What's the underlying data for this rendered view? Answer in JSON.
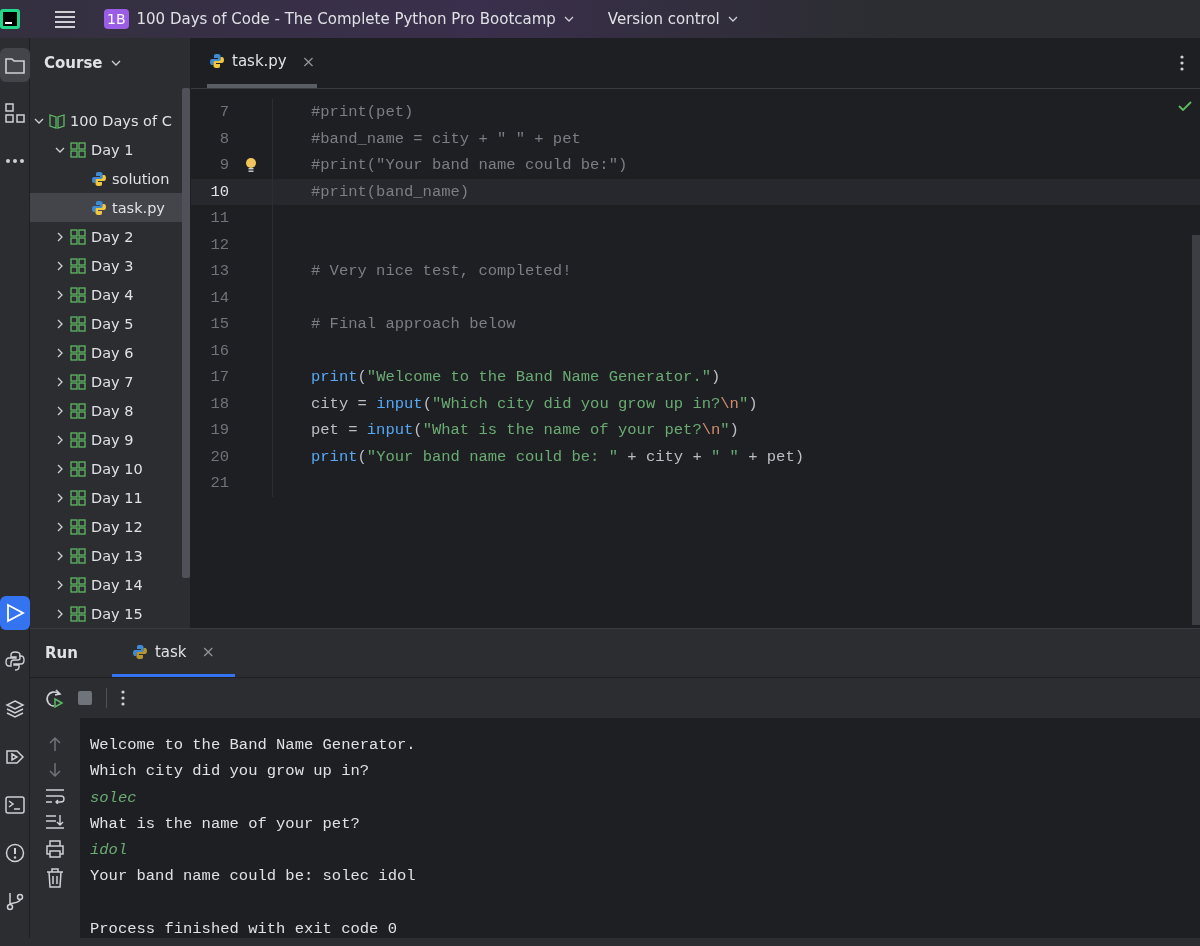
{
  "title_bar": {
    "project_badge": "1B",
    "project": "100 Days of Code - The Complete Python Pro Bootcamp",
    "vcs": "Version control"
  },
  "left_toolbar": {
    "top": [
      {
        "selected": true
      },
      {
        "selected": false
      },
      {
        "selected": false
      }
    ],
    "bottom": [
      {
        "selected": true
      },
      {
        "selected": false
      },
      {
        "selected": false
      },
      {
        "selected": false
      },
      {
        "selected": false
      },
      {
        "selected": false
      },
      {
        "selected": false
      }
    ]
  },
  "project_panel": {
    "title": "Course",
    "tree": [
      {
        "label": "100 Days of C",
        "kind": "course",
        "expanded": true,
        "selected": false,
        "children": [
          {
            "label": "Day 1",
            "kind": "lesson",
            "expanded": true,
            "selected": false,
            "children": [
              {
                "label": "solution",
                "kind": "file",
                "selected": false
              },
              {
                "label": "task.py",
                "kind": "file",
                "selected": true
              }
            ]
          },
          {
            "label": "Day 2",
            "kind": "lesson",
            "expanded": false,
            "selected": false
          },
          {
            "label": "Day 3",
            "kind": "lesson",
            "expanded": false,
            "selected": false
          },
          {
            "label": "Day 4",
            "kind": "lesson",
            "expanded": false,
            "selected": false
          },
          {
            "label": "Day 5",
            "kind": "lesson",
            "expanded": false,
            "selected": false
          },
          {
            "label": "Day 6",
            "kind": "lesson",
            "expanded": false,
            "selected": false
          },
          {
            "label": "Day 7",
            "kind": "lesson",
            "expanded": false,
            "selected": false
          },
          {
            "label": "Day 8",
            "kind": "lesson",
            "expanded": false,
            "selected": false
          },
          {
            "label": "Day 9",
            "kind": "lesson",
            "expanded": false,
            "selected": false
          },
          {
            "label": "Day 10",
            "kind": "lesson",
            "expanded": false,
            "selected": false
          },
          {
            "label": "Day 11",
            "kind": "lesson",
            "expanded": false,
            "selected": false
          },
          {
            "label": "Day 12",
            "kind": "lesson",
            "expanded": false,
            "selected": false
          },
          {
            "label": "Day 13",
            "kind": "lesson",
            "expanded": false,
            "selected": false
          },
          {
            "label": "Day 14",
            "kind": "lesson",
            "expanded": false,
            "selected": false
          },
          {
            "label": "Day 15",
            "kind": "lesson",
            "expanded": false,
            "selected": false
          }
        ]
      }
    ]
  },
  "editor": {
    "tabs": [
      {
        "label": "task.py",
        "selected": true,
        "close": "×"
      }
    ],
    "lines": [
      {
        "number": "7",
        "current": false,
        "tokens": [
          {
            "kind": "comment",
            "text": "#print(pet)"
          }
        ]
      },
      {
        "number": "8",
        "current": false,
        "tokens": [
          {
            "kind": "comment",
            "text": "#band_name = city + \" \" + pet"
          }
        ]
      },
      {
        "number": "9",
        "current": false,
        "hint": true,
        "tokens": [
          {
            "kind": "comment",
            "text": "#print(\"Your band name could be:\")"
          }
        ]
      },
      {
        "number": "10",
        "current": true,
        "tokens": [
          {
            "kind": "comment",
            "text": "#print(band_name)"
          }
        ]
      },
      {
        "number": "11",
        "current": false
      },
      {
        "number": "12",
        "current": false
      },
      {
        "number": "13",
        "current": false,
        "tokens": [
          {
            "kind": "comment",
            "text": "# Very nice test, completed!"
          }
        ]
      },
      {
        "number": "14",
        "current": false
      },
      {
        "number": "15",
        "current": false,
        "tokens": [
          {
            "kind": "comment",
            "text": "# Final approach below"
          }
        ]
      },
      {
        "number": "16",
        "current": false
      },
      {
        "number": "17",
        "current": false,
        "tokens": [
          {
            "kind": "builtin",
            "text": "print"
          },
          {
            "kind": "plain",
            "text": "("
          },
          {
            "kind": "string",
            "text": "\"Welcome to the Band Name Generator.\""
          },
          {
            "kind": "plain",
            "text": ")"
          }
        ]
      },
      {
        "number": "18",
        "current": false,
        "tokens": [
          {
            "kind": "plain",
            "text": "city = "
          },
          {
            "kind": "builtin",
            "text": "input"
          },
          {
            "kind": "plain",
            "text": "("
          },
          {
            "kind": "string",
            "text": "\"Which city did you grow up in?"
          },
          {
            "kind": "escape",
            "text": "\\n"
          },
          {
            "kind": "string",
            "text": "\""
          },
          {
            "kind": "plain",
            "text": ")"
          }
        ]
      },
      {
        "number": "19",
        "current": false,
        "tokens": [
          {
            "kind": "plain",
            "text": "pet = "
          },
          {
            "kind": "builtin",
            "text": "input"
          },
          {
            "kind": "plain",
            "text": "("
          },
          {
            "kind": "string",
            "text": "\"What is the name of your pet?"
          },
          {
            "kind": "escape",
            "text": "\\n"
          },
          {
            "kind": "string",
            "text": "\""
          },
          {
            "kind": "plain",
            "text": ")"
          }
        ]
      },
      {
        "number": "20",
        "current": false,
        "tokens": [
          {
            "kind": "builtin",
            "text": "print"
          },
          {
            "kind": "plain",
            "text": "("
          },
          {
            "kind": "string",
            "text": "\"Your band name could be: \""
          },
          {
            "kind": "plain",
            "text": " + city + "
          },
          {
            "kind": "string",
            "text": "\" \""
          },
          {
            "kind": "plain",
            "text": " + pet)"
          }
        ]
      },
      {
        "number": "21",
        "current": false
      }
    ]
  },
  "run_panel": {
    "title": "Run",
    "tabs": [
      {
        "label": "task",
        "selected": true,
        "close": "×"
      }
    ],
    "console": [
      {
        "kind": "output",
        "text": "Welcome to the Band Name Generator."
      },
      {
        "kind": "output",
        "text": "Which city did you grow up in?"
      },
      {
        "kind": "input",
        "text": "solec"
      },
      {
        "kind": "output",
        "text": "What is the name of your pet?"
      },
      {
        "kind": "input",
        "text": "idol"
      },
      {
        "kind": "output",
        "text": "Your band name could be: solec idol"
      },
      {
        "kind": "blank"
      },
      {
        "kind": "output",
        "text": "Process finished with exit code 0"
      }
    ]
  }
}
